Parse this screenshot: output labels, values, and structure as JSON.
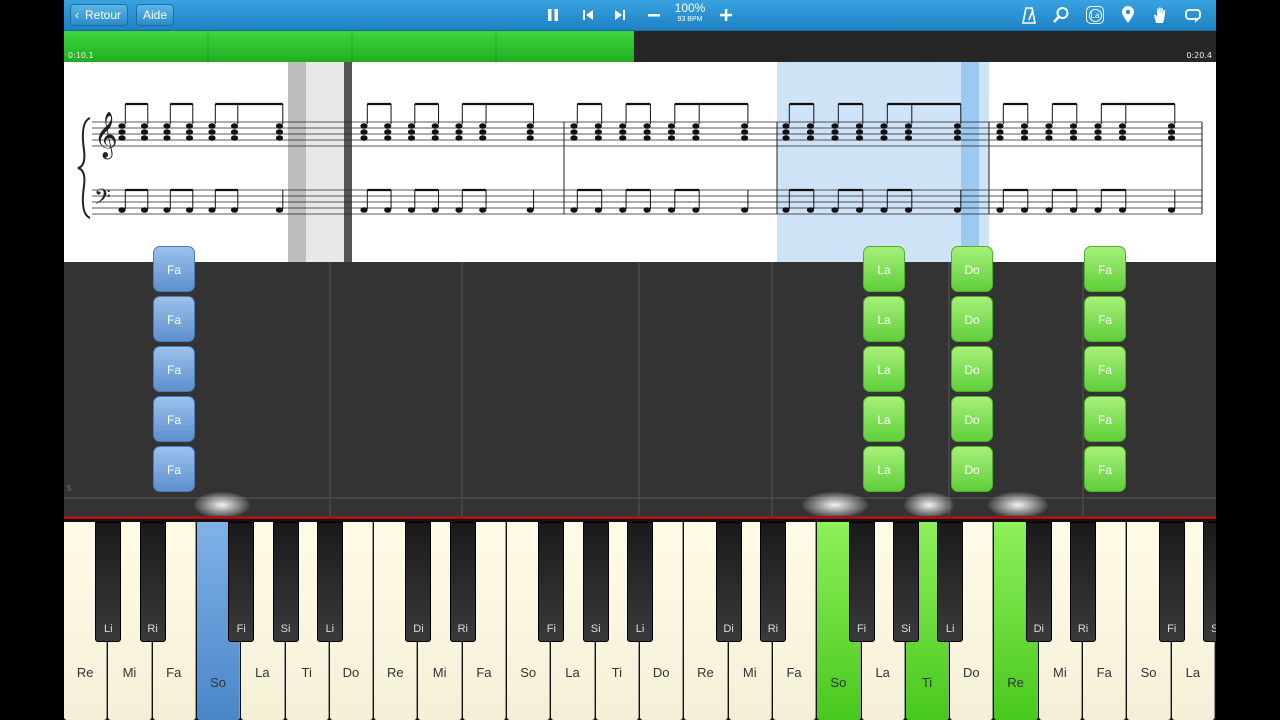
{
  "toolbar": {
    "back_label": "Retour",
    "help_label": "Aide",
    "zoom_value": "100%",
    "tempo_value": "93 BPM",
    "icons": [
      "pause-icon",
      "skip-back-icon",
      "skip-forward-icon",
      "minus-icon",
      "plus-icon",
      "metronome-icon",
      "search-icon",
      "note-name-icon",
      "location-pin-icon",
      "hand-icon",
      "loop-icon"
    ],
    "note_name_badge": "La"
  },
  "progress": {
    "elapsed_label": "0:10.1",
    "total_label": "0:20.4",
    "fraction": 0.495,
    "color": "#2fc42f"
  },
  "roll": {
    "measure_marker": "5",
    "columns": [
      {
        "note": "Fa",
        "color": "blue",
        "count": 5
      },
      {
        "note": "La",
        "color": "green",
        "count": 5
      },
      {
        "note": "Do",
        "color": "green",
        "count": 5
      },
      {
        "note": "Fa",
        "color": "green",
        "count": 5
      }
    ]
  },
  "keyboard": {
    "white_keys": [
      "Re",
      "Mi",
      "Fa",
      "So",
      "La",
      "Ti",
      "Do",
      "Re",
      "Mi",
      "Fa",
      "So",
      "La",
      "Ti",
      "Do",
      "Re",
      "Mi",
      "Fa",
      "So",
      "La",
      "Ti",
      "Do",
      "Re",
      "Mi",
      "Fa",
      "So",
      "La"
    ],
    "black_keys": [
      "Li",
      "Ri",
      "Fi",
      "Si",
      "Li",
      "Di",
      "Ri",
      "Fi",
      "Si",
      "Li",
      "Di",
      "Ri",
      "Fi",
      "Si",
      "Li",
      "Di",
      "Ri",
      "Fi",
      "Si"
    ],
    "pressed_blue": [
      "So"
    ],
    "pressed_green": [
      "So",
      "Ti",
      "Re"
    ],
    "accent_colors": {
      "blue": "#5d8fce",
      "green": "#5fcf3a",
      "bar": "#a3131a"
    }
  }
}
